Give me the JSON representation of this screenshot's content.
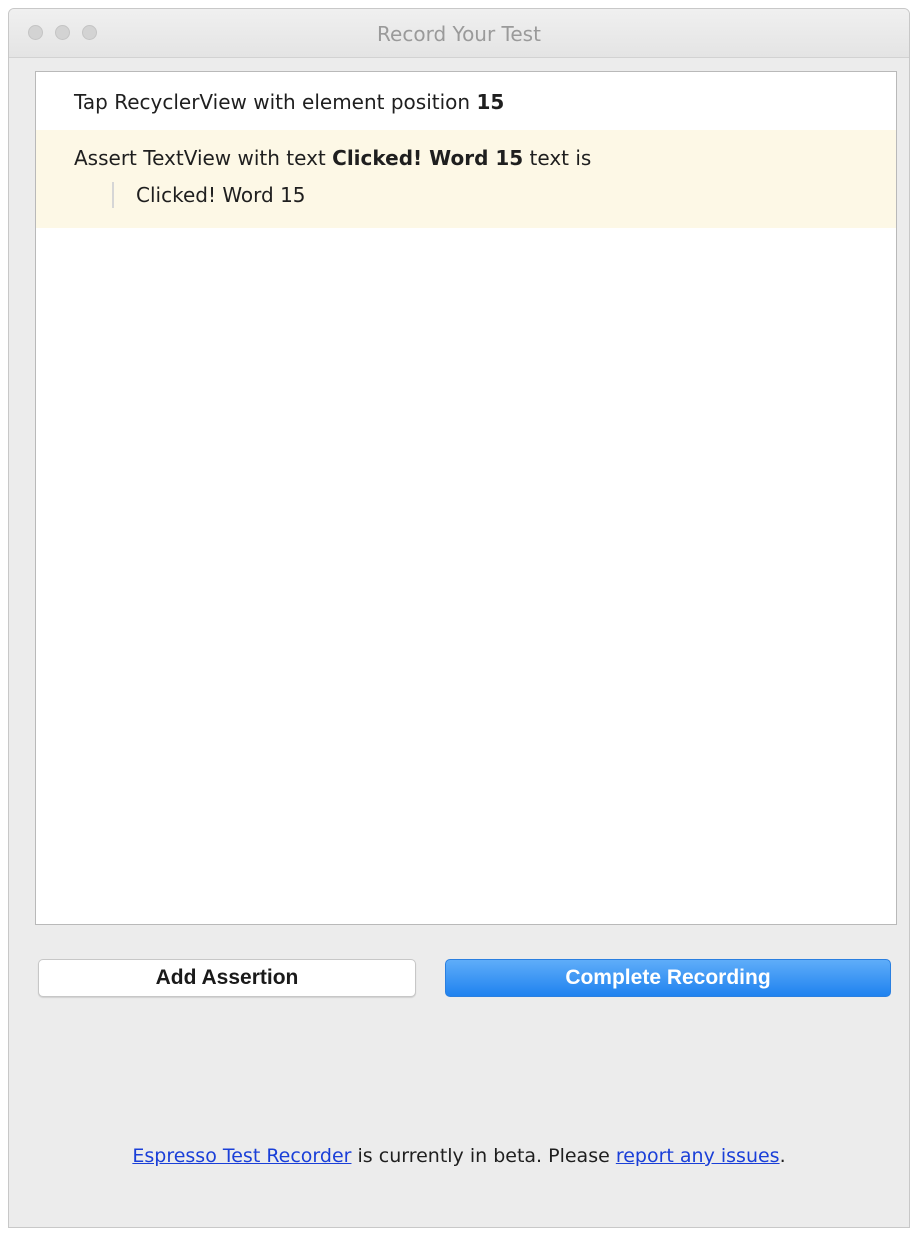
{
  "window": {
    "title": "Record Your Test"
  },
  "steps": [
    {
      "action_prefix": "Tap RecyclerView with element position ",
      "action_value": "15"
    },
    {
      "action_prefix": "Assert TextView with text ",
      "action_value": "Clicked! Word 15",
      "action_suffix": " text is",
      "detail": "Clicked! Word 15",
      "highlighted": true
    }
  ],
  "buttons": {
    "add_assertion": "Add Assertion",
    "complete_recording": "Complete Recording"
  },
  "footer": {
    "link1": "Espresso Test Recorder",
    "middle_text": " is currently in beta. Please ",
    "link2": "report any issues",
    "end_text": "."
  },
  "colors": {
    "highlight_row": "#fdf8e6",
    "primary_button": "#1f82ef",
    "link": "#1a3fd8"
  }
}
